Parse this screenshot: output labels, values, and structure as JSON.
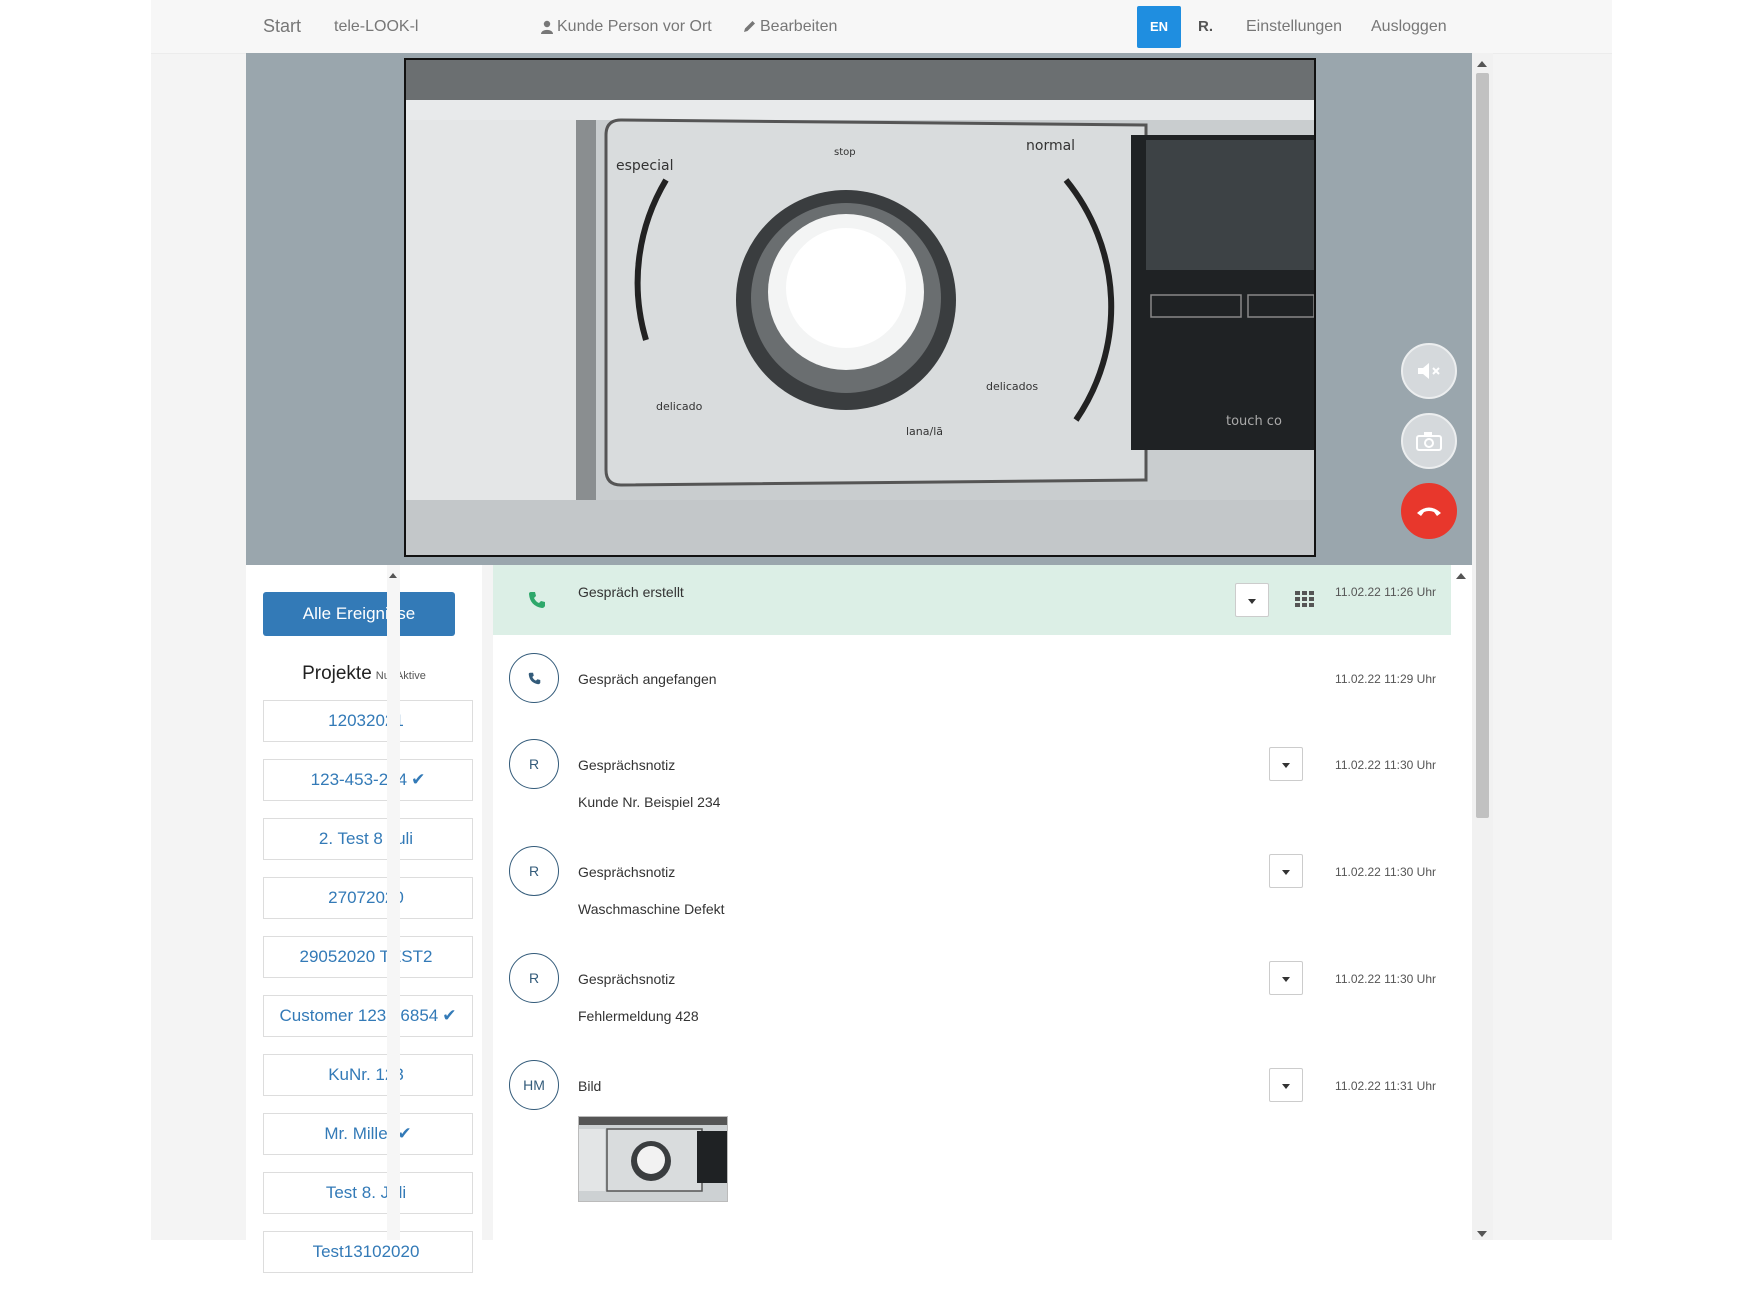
{
  "nav": {
    "brand": "Start",
    "session": "tele-LOOK-l",
    "customer_person": "Kunde Person vor Ort",
    "edit": "Bearbeiten",
    "lang": "EN",
    "user": "R.",
    "settings": "Einstellungen",
    "logout": "Ausloggen"
  },
  "video_controls": {
    "mute_icon": "speaker-mute-icon",
    "snapshot_icon": "camera-icon",
    "hangup_icon": "phone-hangup-icon",
    "hangup_color": "#e8372c"
  },
  "sidebar": {
    "all_events_label": "Alle Ereignisse",
    "projects_title": "Projekte",
    "projects_filter": "Nur Aktive",
    "projects": [
      {
        "label": "12032021",
        "check": ""
      },
      {
        "label": "123-453-284",
        "check": "✔"
      },
      {
        "label": "2. Test 8 Juli",
        "check": ""
      },
      {
        "label": "27072020",
        "check": ""
      },
      {
        "label": "29052020 TEST2",
        "check": ""
      },
      {
        "label": "Customer 123 76854",
        "check": "✔"
      },
      {
        "label": "KuNr. 123",
        "check": ""
      },
      {
        "label": "Mr. Miller",
        "check": "✔"
      },
      {
        "label": "Test 8. Juli",
        "check": ""
      },
      {
        "label": "Test13102020",
        "check": ""
      }
    ]
  },
  "events": [
    {
      "icon": "phone-icon",
      "title": "Gespräch erstellt",
      "sub": "",
      "time": "11.02.22 11:26 Uhr"
    },
    {
      "badge": "",
      "title": "Gespräch angefangen",
      "sub": "",
      "time": "11.02.22 11:29 Uhr"
    },
    {
      "badge": "R",
      "title": "Gesprächsnotiz",
      "sub": "Kunde Nr. Beispiel 234",
      "time": "11.02.22 11:30 Uhr"
    },
    {
      "badge": "R",
      "title": "Gesprächsnotiz",
      "sub": "Waschmaschine Defekt",
      "time": "11.02.22 11:30 Uhr"
    },
    {
      "badge": "R",
      "title": "Gesprächsnotiz",
      "sub": "Fehlermeldung 428",
      "time": "11.02.22 11:30 Uhr"
    },
    {
      "badge": "HM",
      "title": "Bild",
      "sub": "",
      "time": "11.02.22 11:31 Uhr"
    }
  ],
  "colors": {
    "primary": "#337ab7",
    "lang_active": "#1f8ee0",
    "first_event_bg": "#dcefe6"
  }
}
